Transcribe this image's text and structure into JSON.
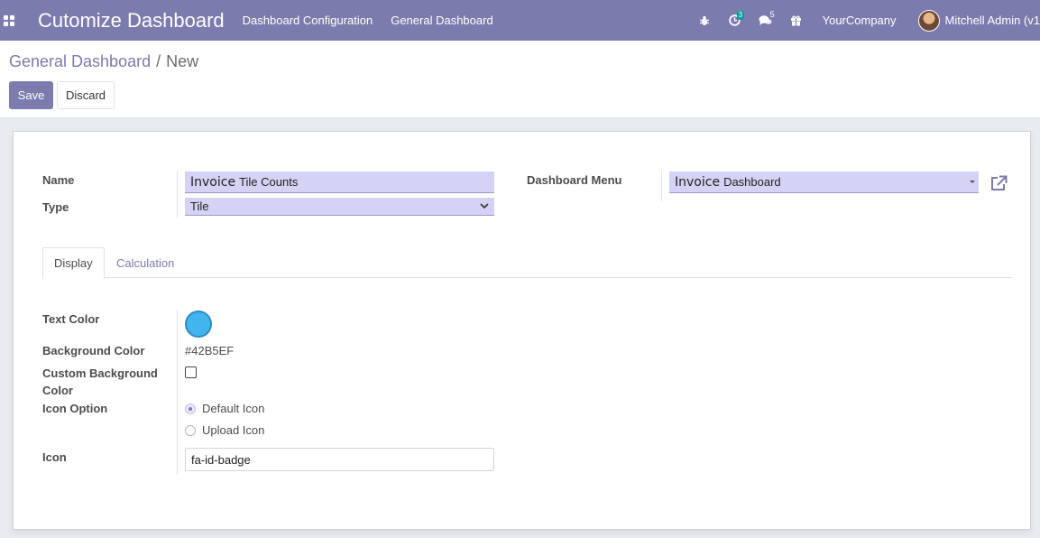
{
  "navbar": {
    "apps_icon": "apps-grid-icon",
    "brand": "Cutomize Dashboard",
    "menus": [
      "Dashboard Configuration",
      "General Dashboard"
    ],
    "systray": {
      "bug_icon": "bug-icon",
      "activity_icon": "clock-icon",
      "activity_count": "3",
      "messages_icon": "chat-icon",
      "messages_count": "5",
      "gift_icon": "gift-icon"
    },
    "company": "YourCompany",
    "user": "Mitchell Admin (v1"
  },
  "breadcrumb": {
    "parent": "General Dashboard",
    "separator": "/",
    "current": "New"
  },
  "actions": {
    "save": "Save",
    "discard": "Discard"
  },
  "form": {
    "name_label": "Name",
    "name_value_prefix": "Invoice",
    "name_value_suffix": "Tile Counts",
    "type_label": "Type",
    "type_value": "Tile",
    "dashboard_menu_label": "Dashboard Menu",
    "dashboard_menu_value_prefix": "Invoice",
    "dashboard_menu_value_suffix": "Dashboard",
    "external_link_icon": "external-link-icon"
  },
  "tabs": [
    "Display",
    "Calculation"
  ],
  "display": {
    "text_color_label": "Text Color",
    "text_color_value": "#42B5EF",
    "background_color_label": "Background Color",
    "background_color_value": "#42B5EF",
    "custom_bg_label_line1": "Custom Background",
    "custom_bg_label_line2": "Color",
    "custom_bg_checked": false,
    "icon_option_label": "Icon Option",
    "icon_options": [
      "Default Icon",
      "Upload Icon"
    ],
    "icon_option_selected": "Default Icon",
    "icon_label": "Icon",
    "icon_value": "fa-id-badge"
  },
  "colors": {
    "navbar": "#7c7bad",
    "primary": "#7c7bad",
    "required_field": "#d4d3f5",
    "badge": "#00a09d"
  }
}
